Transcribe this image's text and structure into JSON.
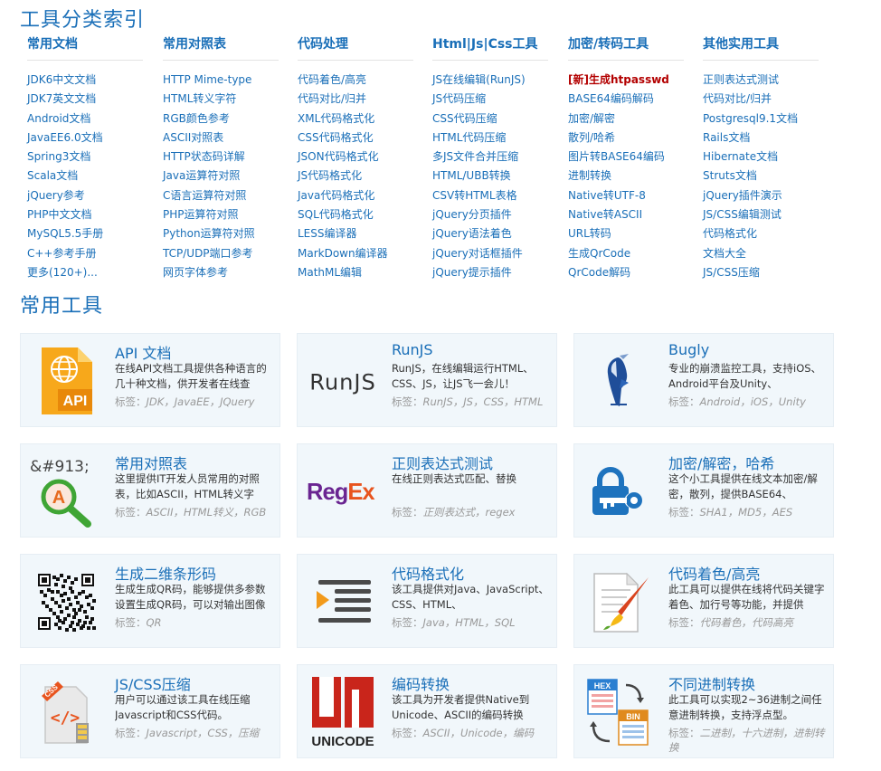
{
  "titles": {
    "index": "工具分类索引",
    "common": "常用工具"
  },
  "categories": [
    {
      "heading": "常用文档",
      "items": [
        {
          "label": "JDK6中文文档"
        },
        {
          "label": "JDK7英文文档"
        },
        {
          "label": "Android文档"
        },
        {
          "label": "JavaEE6.0文档"
        },
        {
          "label": "Spring3文档"
        },
        {
          "label": "Scala文档"
        },
        {
          "label": "jQuery参考"
        },
        {
          "label": "PHP中文文档"
        },
        {
          "label": "MySQL5.5手册"
        },
        {
          "label": "C++参考手册"
        },
        {
          "label": "更多(120+)..."
        }
      ]
    },
    {
      "heading": "常用对照表",
      "items": [
        {
          "label": "HTTP Mime-type"
        },
        {
          "label": "HTML转义字符"
        },
        {
          "label": "RGB颜色参考"
        },
        {
          "label": "ASCII对照表"
        },
        {
          "label": "HTTP状态码详解"
        },
        {
          "label": "Java运算符对照"
        },
        {
          "label": "C语言运算符对照"
        },
        {
          "label": "PHP运算符对照"
        },
        {
          "label": "Python运算符对照"
        },
        {
          "label": "TCP/UDP端口参考"
        },
        {
          "label": "网页字体参考"
        }
      ]
    },
    {
      "heading": "代码处理",
      "items": [
        {
          "label": "代码着色/高亮"
        },
        {
          "label": "代码对比/归并"
        },
        {
          "label": "XML代码格式化"
        },
        {
          "label": "CSS代码格式化"
        },
        {
          "label": "JSON代码格式化"
        },
        {
          "label": "JS代码格式化"
        },
        {
          "label": "Java代码格式化"
        },
        {
          "label": "SQL代码格式化"
        },
        {
          "label": "LESS编译器"
        },
        {
          "label": "MarkDown编译器"
        },
        {
          "label": "MathML编辑"
        }
      ]
    },
    {
      "heading": "Html|Js|Css工具",
      "items": [
        {
          "label": "JS在线编辑(RunJS)"
        },
        {
          "label": "JS代码压缩"
        },
        {
          "label": "CSS代码压缩"
        },
        {
          "label": "HTML代码压缩"
        },
        {
          "label": "多JS文件合并压缩"
        },
        {
          "label": "HTML/UBB转换"
        },
        {
          "label": "CSV转HTML表格"
        },
        {
          "label": "jQuery分页插件"
        },
        {
          "label": "jQuery语法着色"
        },
        {
          "label": "jQuery对话框插件"
        },
        {
          "label": "jQuery提示插件"
        }
      ]
    },
    {
      "heading": "加密/转码工具",
      "items": [
        {
          "label": "[新]生成htpasswd",
          "hot": true
        },
        {
          "label": "BASE64编码解码"
        },
        {
          "label": "加密/解密"
        },
        {
          "label": "散列/哈希"
        },
        {
          "label": "图片转BASE64编码"
        },
        {
          "label": "进制转换"
        },
        {
          "label": "Native转UTF-8"
        },
        {
          "label": "Native转ASCII"
        },
        {
          "label": "URL转码"
        },
        {
          "label": "生成QrCode"
        },
        {
          "label": "QrCode解码"
        }
      ]
    },
    {
      "heading": "其他实用工具",
      "items": [
        {
          "label": "正则表达式测试"
        },
        {
          "label": "代码对比/归并"
        },
        {
          "label": "Postgresql9.1文档"
        },
        {
          "label": "Rails文档"
        },
        {
          "label": "Hibernate文档"
        },
        {
          "label": "Struts文档"
        },
        {
          "label": "jQuery插件演示"
        },
        {
          "label": "JS/CSS编辑测试"
        },
        {
          "label": "代码格式化"
        },
        {
          "label": "文档大全"
        },
        {
          "label": "JS/CSS压缩"
        }
      ]
    }
  ],
  "cards": [
    {
      "key": "api",
      "title": "API 文档",
      "desc": "在线API文档工具提供各种语言的几十种文档，供开发者在线查",
      "tags": "JDK，JavaEE，JQuery",
      "icon": "api-doc-icon",
      "icon_text": "API"
    },
    {
      "key": "runjs",
      "title": "RunJS",
      "desc": "RunJS，在线编辑运行HTML、CSS、JS，让JS飞一会儿！",
      "tags": "RunJS，JS，CSS，HTML",
      "icon": "runjs-logo",
      "icon_text": "RunJS"
    },
    {
      "key": "bugly",
      "title": "Bugly",
      "desc": "专业的崩溃监控工具，支持iOS、Android平台及Unity、",
      "tags": "Android，iOS，Unity",
      "icon": "bugly-bird-icon"
    },
    {
      "key": "ref",
      "title": "常用对照表",
      "desc": "这里提供IT开发人员常用的对照表，比如ASCII，HTML转义字",
      "tags": "ASCII，HTML转义，RGB",
      "icon": "magnifier-icon",
      "icon_text": "&#913;",
      "icon_text2": "A"
    },
    {
      "key": "regex",
      "title": "正则表达式测试",
      "desc": "在线正则表达式匹配、替换",
      "tags": "正则表达式，regex",
      "icon": "regex-logo",
      "icon_text": "Reg",
      "icon_text2": "Ex"
    },
    {
      "key": "crypto",
      "title": "加密/解密，哈希",
      "desc": "这个小工具提供在线文本加密/解密，散列，提供BASE64、",
      "tags": "SHA1，MD5，AES",
      "icon": "lock-key-icon"
    },
    {
      "key": "qr",
      "title": "生成二维条形码",
      "desc": "生成生成QR码，能够提供多参数设置生成QR码，可以对输出图像",
      "tags": "QR",
      "icon": "qrcode-icon"
    },
    {
      "key": "fmt",
      "title": "代码格式化",
      "desc": "该工具提供对Java、JavaScript、CSS、HTML、",
      "tags": "Java，HTML，SQL",
      "icon": "indent-lines-icon"
    },
    {
      "key": "hl",
      "title": "代码着色/高亮",
      "desc": "此工具可以提供在线将代码关键字着色、加行号等功能，并提供",
      "tags": "代码着色，代码高亮",
      "icon": "paintbrush-doc-icon"
    },
    {
      "key": "jscss",
      "title": "JS/CSS压缩",
      "desc": "用户可以通过该工具在线压缩Javascript和CSS代码。",
      "tags": "Javascript，CSS，压缩",
      "icon": "css-zip-icon",
      "icon_text": "CSS",
      "icon_text2": "</>"
    },
    {
      "key": "enc",
      "title": "编码转换",
      "desc": "该工具为开发者提供Native到Unicode、ASCII的编码转换",
      "tags": "ASCII，Unicode，编码",
      "icon": "unicode-logo",
      "icon_text": "UNICODE"
    },
    {
      "key": "radix",
      "title": "不同进制转换",
      "desc": "此工具可以实现2~36进制之间任意进制转换，支持浮点型。",
      "tags": "二进制，十六进制，进制转换",
      "icon": "hex-bin-icon",
      "icon_text": "HEX",
      "icon_text2": "BIN"
    }
  ],
  "tag_label": "标签：",
  "colors": {
    "link": "#1a6fb8",
    "hot": "#b30000",
    "card_bg": "#f1f7fb",
    "tags": "#999999"
  }
}
